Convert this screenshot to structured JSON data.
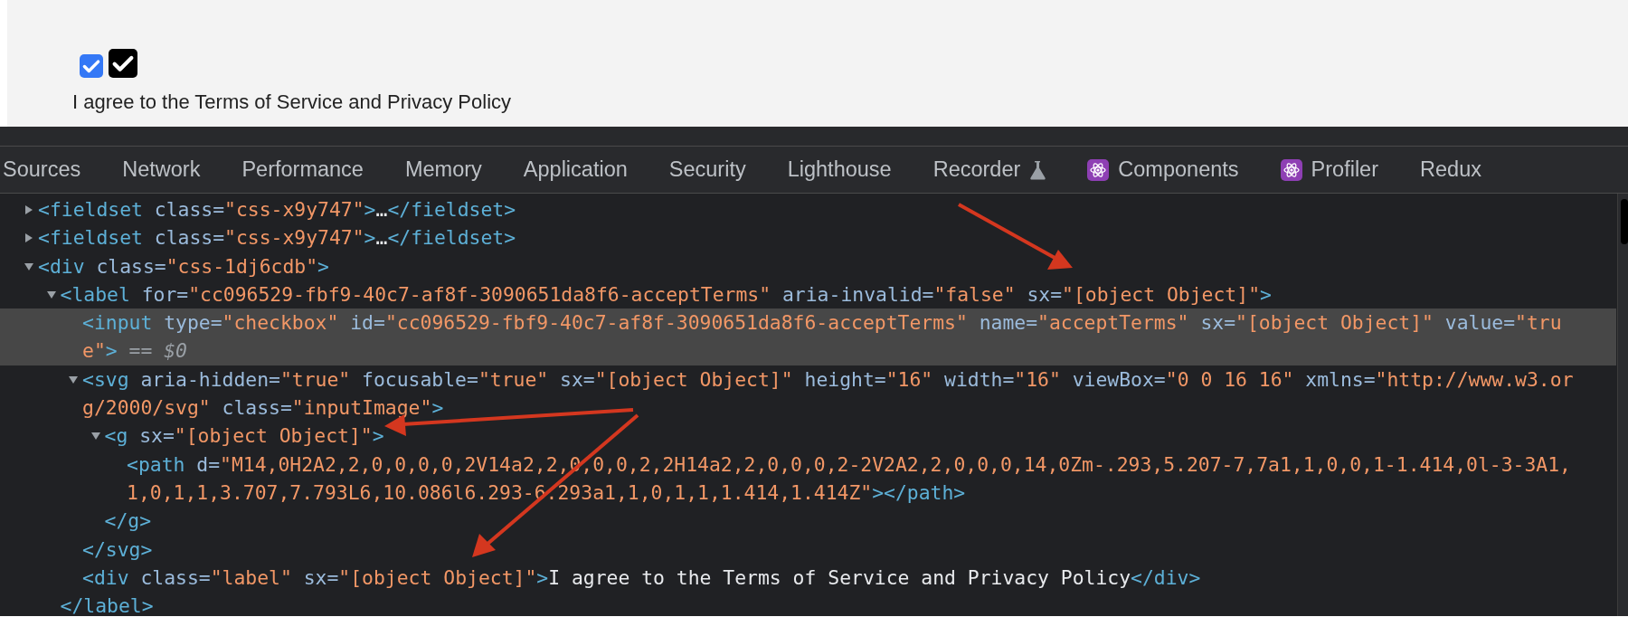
{
  "form": {
    "checkboxes": [
      {
        "kind": "native",
        "checked": true
      },
      {
        "kind": "custom",
        "checked": true
      }
    ],
    "label": "I agree to the Terms of Service and Privacy Policy"
  },
  "devtools": {
    "tabs": [
      {
        "label": "Sources",
        "kind": "plain",
        "selected": false
      },
      {
        "label": "Network",
        "kind": "plain",
        "selected": false
      },
      {
        "label": "Performance",
        "kind": "plain",
        "selected": false
      },
      {
        "label": "Memory",
        "kind": "plain",
        "selected": false
      },
      {
        "label": "Application",
        "kind": "plain",
        "selected": false
      },
      {
        "label": "Security",
        "kind": "plain",
        "selected": false
      },
      {
        "label": "Lighthouse",
        "kind": "plain",
        "selected": false
      },
      {
        "label": "Recorder",
        "kind": "experiment",
        "selected": false
      },
      {
        "label": "Components",
        "kind": "extension",
        "selected": false
      },
      {
        "label": "Profiler",
        "kind": "extension",
        "selected": false
      },
      {
        "label": "Redux",
        "kind": "plain",
        "selected": false
      }
    ],
    "elements": [
      {
        "expanded": false,
        "selected": false,
        "lines": [
          [
            {
              "kind": "tag",
              "text": "<fieldset"
            },
            {
              "kind": "attr",
              "text": " class="
            },
            {
              "kind": "value",
              "text": "\"css-x9y747\""
            },
            {
              "kind": "tag",
              "text": ">"
            },
            {
              "kind": "text",
              "text": "…"
            },
            {
              "kind": "tag",
              "text": "</fieldset>"
            }
          ]
        ]
      },
      {
        "expanded": false,
        "selected": false,
        "lines": [
          [
            {
              "kind": "tag",
              "text": "<fieldset"
            },
            {
              "kind": "attr",
              "text": " class="
            },
            {
              "kind": "value",
              "text": "\"css-x9y747\""
            },
            {
              "kind": "tag",
              "text": ">"
            },
            {
              "kind": "text",
              "text": "…"
            },
            {
              "kind": "tag",
              "text": "</fieldset>"
            }
          ]
        ]
      },
      {
        "expanded": true,
        "selected": false,
        "lines": [
          [
            {
              "kind": "tag",
              "text": "<div"
            },
            {
              "kind": "attr",
              "text": " class="
            },
            {
              "kind": "value",
              "text": "\"css-1dj6cdb\""
            },
            {
              "kind": "tag",
              "text": ">"
            }
          ]
        ],
        "children": [
          {
            "expanded": true,
            "selected": false,
            "lines": [
              [
                {
                  "kind": "tag",
                  "text": "<label"
                },
                {
                  "kind": "attr",
                  "text": " for="
                },
                {
                  "kind": "value",
                  "text": "\"cc096529-fbf9-40c7-af8f-3090651da8f6-acceptTerms\""
                },
                {
                  "kind": "attr",
                  "text": " aria-invalid="
                },
                {
                  "kind": "value",
                  "text": "\"false\""
                },
                {
                  "kind": "attr",
                  "text": " sx="
                },
                {
                  "kind": "value",
                  "text": "\"[object Object]\""
                },
                {
                  "kind": "tag",
                  "text": ">"
                }
              ]
            ],
            "close": [
              {
                "kind": "tag",
                "text": "</label>"
              }
            ],
            "children": [
              {
                "selected": true,
                "lines": [
                  [
                    {
                      "kind": "tag",
                      "text": "<input"
                    },
                    {
                      "kind": "attr",
                      "text": " type="
                    },
                    {
                      "kind": "value",
                      "text": "\"checkbox\""
                    },
                    {
                      "kind": "attr",
                      "text": " id="
                    },
                    {
                      "kind": "value",
                      "text": "\"cc096529-fbf9-40c7-af8f-3090651da8f6-acceptTerms\""
                    },
                    {
                      "kind": "attr",
                      "text": " name="
                    },
                    {
                      "kind": "value",
                      "text": "\"acceptTerms\""
                    },
                    {
                      "kind": "attr",
                      "text": " sx="
                    },
                    {
                      "kind": "value",
                      "text": "\"[object Object]\""
                    },
                    {
                      "kind": "attr",
                      "text": " value="
                    },
                    {
                      "kind": "value",
                      "text": "\"tru"
                    }
                  ],
                  [
                    {
                      "kind": "value",
                      "text": "e\""
                    },
                    {
                      "kind": "tag",
                      "text": ">"
                    },
                    {
                      "kind": "marker",
                      "text": " == $0"
                    }
                  ]
                ]
              },
              {
                "expanded": true,
                "selected": false,
                "lines": [
                  [
                    {
                      "kind": "tag",
                      "text": "<svg"
                    },
                    {
                      "kind": "attr",
                      "text": " aria-hidden="
                    },
                    {
                      "kind": "value",
                      "text": "\"true\""
                    },
                    {
                      "kind": "attr",
                      "text": " focusable="
                    },
                    {
                      "kind": "value",
                      "text": "\"true\""
                    },
                    {
                      "kind": "attr",
                      "text": " sx="
                    },
                    {
                      "kind": "value",
                      "text": "\"[object Object]\""
                    },
                    {
                      "kind": "attr",
                      "text": " height="
                    },
                    {
                      "kind": "value",
                      "text": "\"16\""
                    },
                    {
                      "kind": "attr",
                      "text": " width="
                    },
                    {
                      "kind": "value",
                      "text": "\"16\""
                    },
                    {
                      "kind": "attr",
                      "text": " viewBox="
                    },
                    {
                      "kind": "value",
                      "text": "\"0 0 16 16\""
                    },
                    {
                      "kind": "attr",
                      "text": " xmlns="
                    },
                    {
                      "kind": "value",
                      "text": "\"http://www.w3.or"
                    }
                  ],
                  [
                    {
                      "kind": "value",
                      "text": "g/2000/svg\""
                    },
                    {
                      "kind": "attr",
                      "text": " class="
                    },
                    {
                      "kind": "value",
                      "text": "\"inputImage\""
                    },
                    {
                      "kind": "tag",
                      "text": ">"
                    }
                  ]
                ],
                "close": [
                  {
                    "kind": "tag",
                    "text": "</svg>"
                  }
                ],
                "children": [
                  {
                    "expanded": true,
                    "selected": false,
                    "lines": [
                      [
                        {
                          "kind": "tag",
                          "text": "<g"
                        },
                        {
                          "kind": "attr",
                          "text": " sx="
                        },
                        {
                          "kind": "value",
                          "text": "\"[object Object]\""
                        },
                        {
                          "kind": "tag",
                          "text": ">"
                        }
                      ]
                    ],
                    "close": [
                      {
                        "kind": "tag",
                        "text": "</g>"
                      }
                    ],
                    "children": [
                      {
                        "selected": false,
                        "lines": [
                          [
                            {
                              "kind": "tag",
                              "text": "<path"
                            },
                            {
                              "kind": "attr",
                              "text": " d="
                            },
                            {
                              "kind": "value",
                              "text": "\"M14,0H2A2,2,0,0,0,0,2V14a2,2,0,0,0,2,2H14a2,2,0,0,0,2-2V2A2,2,0,0,0,14,0Zm-.293,5.207-7,7a1,1,0,0,1-1.414,0l-3-3A1,"
                            }
                          ],
                          [
                            {
                              "kind": "value",
                              "text": "1,0,1,1,3.707,7.793L6,10.086l6.293-6.293a1,1,0,1,1,1.414,1.414Z\""
                            },
                            {
                              "kind": "tag",
                              "text": "></path>"
                            }
                          ]
                        ]
                      }
                    ]
                  }
                ]
              },
              {
                "selected": false,
                "lines": [
                  [
                    {
                      "kind": "tag",
                      "text": "<div"
                    },
                    {
                      "kind": "attr",
                      "text": " class="
                    },
                    {
                      "kind": "value",
                      "text": "\"label\""
                    },
                    {
                      "kind": "attr",
                      "text": " sx="
                    },
                    {
                      "kind": "value",
                      "text": "\"[object Object]\""
                    },
                    {
                      "kind": "tag",
                      "text": ">"
                    },
                    {
                      "kind": "text",
                      "text": "I agree to the Terms of Service and Privacy Policy"
                    },
                    {
                      "kind": "tag",
                      "text": "</div>"
                    }
                  ]
                ]
              }
            ]
          }
        ]
      }
    ]
  }
}
